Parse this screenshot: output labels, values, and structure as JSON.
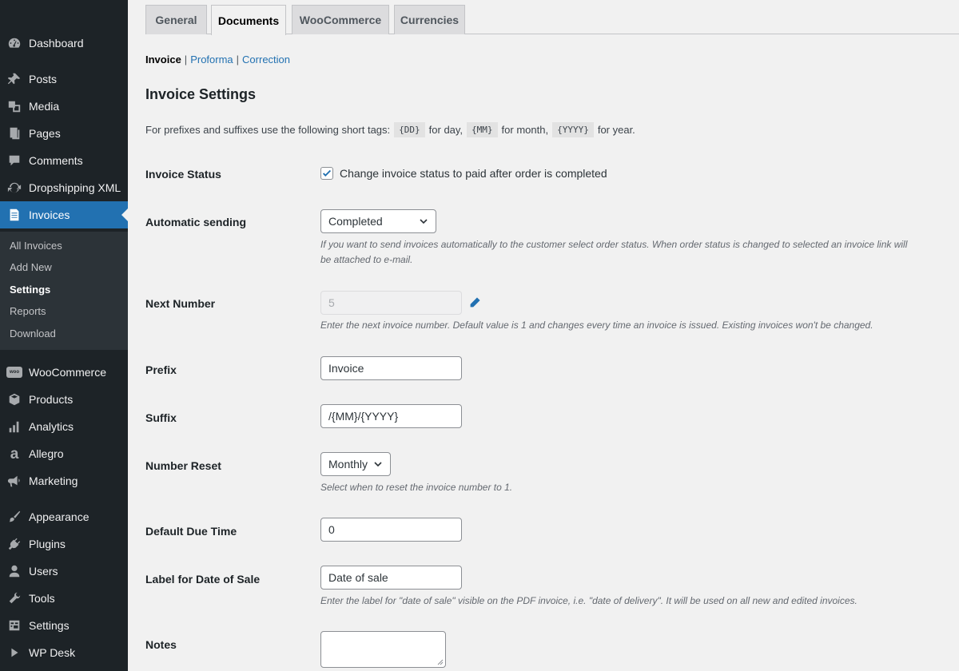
{
  "sidebar": {
    "items": [
      {
        "label": "Dashboard",
        "icon": "dashboard-icon"
      },
      {
        "label": "Posts",
        "icon": "pin-icon"
      },
      {
        "label": "Media",
        "icon": "media-icon"
      },
      {
        "label": "Pages",
        "icon": "pages-icon"
      },
      {
        "label": "Comments",
        "icon": "comments-icon"
      },
      {
        "label": "Dropshipping XML",
        "icon": "sync-icon"
      },
      {
        "label": "Invoices",
        "icon": "invoice-icon"
      },
      {
        "label": "WooCommerce",
        "icon": "woocommerce-icon",
        "badge": "woo"
      },
      {
        "label": "Products",
        "icon": "products-icon"
      },
      {
        "label": "Analytics",
        "icon": "analytics-icon"
      },
      {
        "label": "Allegro",
        "icon": "allegro-icon",
        "glyph": "a"
      },
      {
        "label": "Marketing",
        "icon": "megaphone-icon"
      },
      {
        "label": "Appearance",
        "icon": "paintbrush-icon"
      },
      {
        "label": "Plugins",
        "icon": "plugin-icon"
      },
      {
        "label": "Users",
        "icon": "users-icon"
      },
      {
        "label": "Tools",
        "icon": "wrench-icon"
      },
      {
        "label": "Settings",
        "icon": "settings-icon"
      },
      {
        "label": "WP Desk",
        "icon": "play-icon"
      }
    ],
    "submenu": [
      "All Invoices",
      "Add New",
      "Settings",
      "Reports",
      "Download"
    ],
    "current_item": "Invoices",
    "current_submenu": "Settings"
  },
  "tabs": [
    "General",
    "Documents",
    "WooCommerce",
    "Currencies"
  ],
  "active_tab": "Documents",
  "subnav": {
    "current": "Invoice",
    "links": [
      "Proforma",
      "Correction"
    ],
    "separator": "|"
  },
  "page_title": "Invoice Settings",
  "intro": {
    "before": "For prefixes and suffixes use the following short tags:",
    "tag_day": "{DD}",
    "day_text": "for day,",
    "tag_month": "{MM}",
    "month_text": "for month,",
    "tag_year": "{YYYY}",
    "year_text": "for year."
  },
  "fields": {
    "invoice_status": {
      "label": "Invoice Status",
      "checkbox_label": "Change invoice status to paid after order is completed",
      "checked": true
    },
    "automatic_sending": {
      "label": "Automatic sending",
      "value": "Completed",
      "description_line1": "If you want to send invoices automatically to the customer select order status. When order status is changed to selected an invoice link will",
      "description_line2": "be attached to e-mail."
    },
    "next_number": {
      "label": "Next Number",
      "value": "5",
      "description": "Enter the next invoice number. Default value is 1 and changes every time an invoice is issued. Existing invoices won't be changed."
    },
    "prefix": {
      "label": "Prefix",
      "value": "Invoice"
    },
    "suffix": {
      "label": "Suffix",
      "value": "/{MM}/{YYYY}"
    },
    "number_reset": {
      "label": "Number Reset",
      "value": "Monthly",
      "description": "Select when to reset the invoice number to 1."
    },
    "default_due_time": {
      "label": "Default Due Time",
      "value": "0"
    },
    "date_of_sale_label": {
      "label": "Label for Date of Sale",
      "value": "Date of sale",
      "description": "Enter the label for \"date of sale\" visible on the PDF invoice, i.e. \"date of delivery\". It will be used on all new and edited invoices."
    },
    "notes": {
      "label": "Notes",
      "value": ""
    }
  },
  "colors": {
    "sidebar_bg": "#1d2327",
    "submenu_bg": "#2c3338",
    "accent": "#2271b1",
    "page_bg": "#f1f1f1"
  }
}
